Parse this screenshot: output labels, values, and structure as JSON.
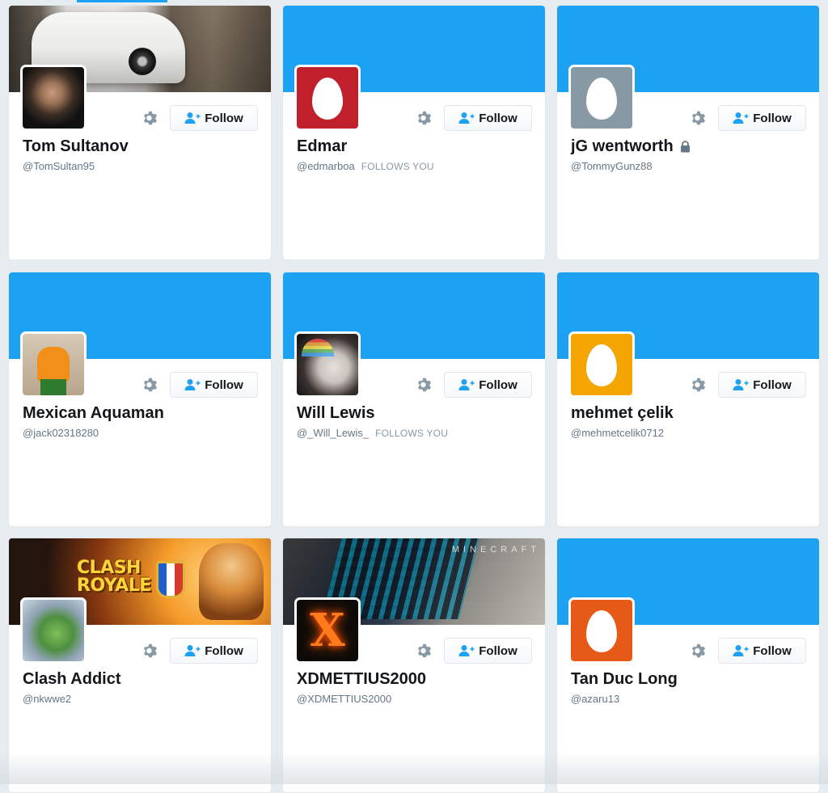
{
  "accent_color": "#1da1f2",
  "follow_label": "Follow",
  "follows_you_label": "FOLLOWS YOU",
  "icons": {
    "settings": "gear-icon",
    "follow": "person-plus-icon",
    "protected": "lock-icon",
    "default_avatar": "egg-icon"
  },
  "cards": [
    {
      "name": "Tom Sultanov",
      "handle": "@TomSultan95",
      "follows_you": false,
      "protected": false,
      "banner": "photo",
      "avatar": "photo"
    },
    {
      "name": "Edmar",
      "handle": "@edmarboa",
      "follows_you": true,
      "protected": false,
      "banner": "blue",
      "avatar": "egg",
      "avatar_color": "#c0202c"
    },
    {
      "name": "jG wentworth",
      "handle": "@TommyGunz88",
      "follows_you": false,
      "protected": true,
      "banner": "blue",
      "avatar": "egg",
      "avatar_color": "#8899a6"
    },
    {
      "name": "Mexican Aquaman",
      "handle": "@jack02318280",
      "follows_you": false,
      "protected": false,
      "banner": "blue",
      "avatar": "photo"
    },
    {
      "name": "Will Lewis",
      "handle": "@_Will_Lewis_",
      "follows_you": true,
      "protected": false,
      "banner": "blue",
      "avatar": "photo"
    },
    {
      "name": "mehmet çelik",
      "handle": "@mehmetcelik0712",
      "follows_you": false,
      "protected": false,
      "banner": "blue",
      "avatar": "egg",
      "avatar_color": "#f5a500"
    },
    {
      "name": "Clash Addict",
      "handle": "@nkwwe2",
      "follows_you": false,
      "protected": false,
      "banner": "photo",
      "avatar": "photo",
      "banner_text": "CLASH ROYALE"
    },
    {
      "name": "XDMETTIUS2000",
      "handle": "@XDMETTIUS2000",
      "follows_you": false,
      "protected": false,
      "banner": "photo",
      "avatar": "photo",
      "banner_text": "MINECRAFT",
      "avatar_text": "X"
    },
    {
      "name": "Tan Duc Long",
      "handle": "@azaru13",
      "follows_you": false,
      "protected": false,
      "banner": "blue",
      "avatar": "egg",
      "avatar_color": "#e55a16"
    }
  ]
}
